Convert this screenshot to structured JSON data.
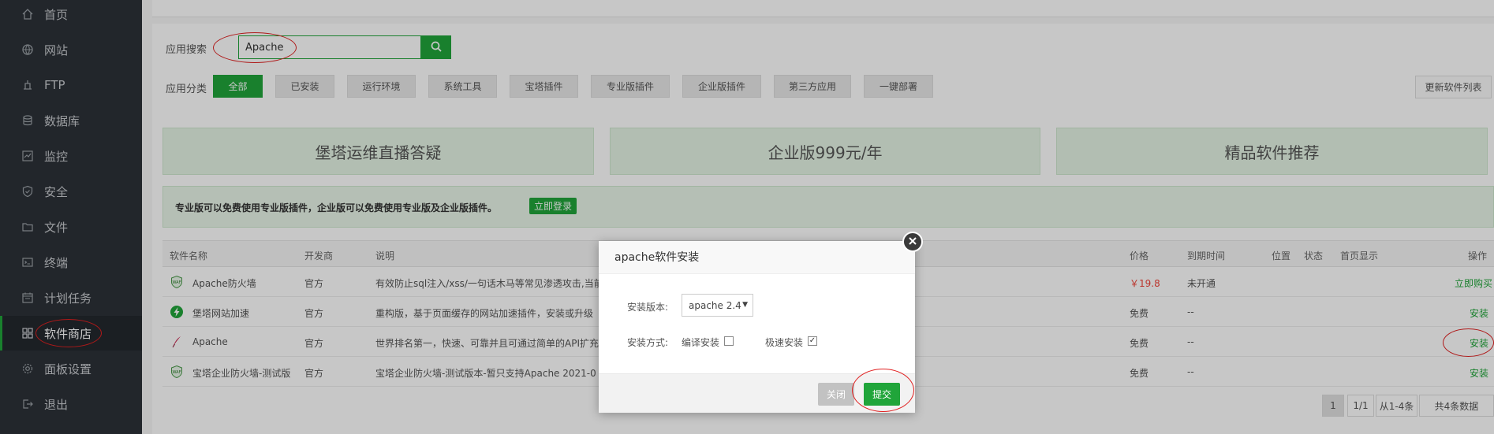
{
  "sidebar": {
    "items": [
      {
        "label": "首页",
        "icon": "home-icon"
      },
      {
        "label": "网站",
        "icon": "globe-icon"
      },
      {
        "label": "FTP",
        "icon": "ftp-icon"
      },
      {
        "label": "数据库",
        "icon": "database-icon"
      },
      {
        "label": "监控",
        "icon": "monitor-icon"
      },
      {
        "label": "安全",
        "icon": "shield-icon"
      },
      {
        "label": "文件",
        "icon": "folder-icon"
      },
      {
        "label": "终端",
        "icon": "terminal-icon"
      },
      {
        "label": "计划任务",
        "icon": "calendar-icon"
      },
      {
        "label": "软件商店",
        "icon": "grid-icon"
      },
      {
        "label": "面板设置",
        "icon": "gear-icon"
      },
      {
        "label": "退出",
        "icon": "logout-icon"
      }
    ]
  },
  "search": {
    "label": "应用搜索",
    "value": "Apache"
  },
  "categories": {
    "label": "应用分类",
    "items": [
      "全部",
      "已安装",
      "运行环境",
      "系统工具",
      "宝塔插件",
      "专业版插件",
      "企业版插件",
      "第三方应用",
      "一键部署"
    ],
    "refresh_label": "更新软件列表"
  },
  "banners": [
    "堡塔运维直播答疑",
    "企业版999元/年",
    "精品软件推荐"
  ],
  "notice": {
    "text": "专业版可以免费使用专业版插件，企业版可以免费使用专业版及企业版插件。",
    "login": "立即登录"
  },
  "table": {
    "headers": {
      "name": "软件名称",
      "dev": "开发商",
      "desc": "说明",
      "price": "价格",
      "expire": "到期时间",
      "position": "位置",
      "status": "状态",
      "home": "首页显示",
      "op": "操作"
    },
    "rows": [
      {
        "name": "Apache防火墙",
        "dev": "官方",
        "desc": "有效防止sql注入/xss/一句话木马等常见渗透攻击,当前",
        "price": "￥19.8",
        "expire": "未开通",
        "op": "立即购买",
        "icon": "waf-icon"
      },
      {
        "name": "堡塔网站加速",
        "dev": "官方",
        "desc": "重构版，基于页面缓存的网站加速插件，安装或升级",
        "price": "免费",
        "expire": "--",
        "op": "安装",
        "icon": "lightning-icon"
      },
      {
        "name": "Apache",
        "dev": "官方",
        "desc": "世界排名第一，快速、可靠并且可通过简单的API扩充",
        "price": "免费",
        "expire": "--",
        "op": "安装",
        "icon": "apache-feather-icon"
      },
      {
        "name": "宝塔企业防火墙-测试版",
        "dev": "官方",
        "desc": "宝塔企业防火墙-测试版本-暂只支持Apache 2021-0",
        "price": "免费",
        "expire": "--",
        "op": "安装",
        "icon": "waf-icon"
      }
    ]
  },
  "pager": {
    "current": "1",
    "pages": "1/1",
    "range": "从1-4条",
    "total": "共4条数据"
  },
  "modal": {
    "title": "apache软件安装",
    "version_label": "安装版本:",
    "version_value": "apache 2.4",
    "method_label": "安装方式:",
    "compile_label": "编译安装",
    "compile_checked": false,
    "fast_label": "极速安装",
    "fast_checked": true,
    "close_label": "关闭",
    "submit_label": "提交"
  },
  "colors": {
    "accent": "#20a53a",
    "sidebar": "#2c3138",
    "price": "#f0453a",
    "annotation": "#e02020"
  }
}
